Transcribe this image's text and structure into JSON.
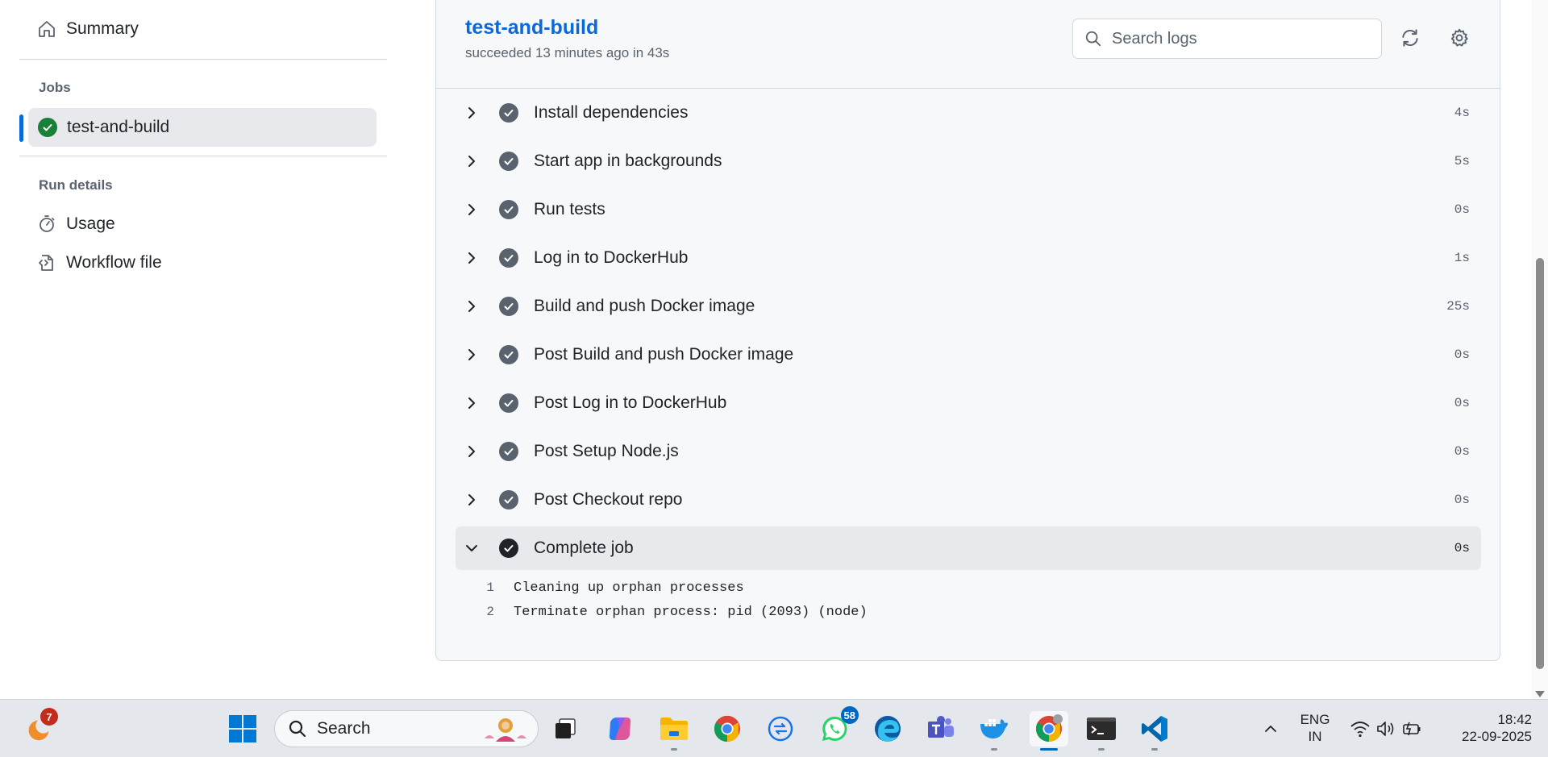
{
  "sidebar": {
    "summary_label": "Summary",
    "jobs_heading": "Jobs",
    "active_job": "test-and-build",
    "run_details_heading": "Run details",
    "usage_label": "Usage",
    "workflow_label": "Workflow file"
  },
  "job": {
    "title": "test-and-build",
    "subtitle": "succeeded 13 minutes ago in 43s",
    "search_placeholder": "Search logs"
  },
  "steps": [
    {
      "name": "Install dependencies",
      "duration": "4s"
    },
    {
      "name": "Start app in backgrounds",
      "duration": "5s"
    },
    {
      "name": "Run tests",
      "duration": "0s"
    },
    {
      "name": "Log in to DockerHub",
      "duration": "1s"
    },
    {
      "name": "Build and push Docker image",
      "duration": "25s"
    },
    {
      "name": "Post Build and push Docker image",
      "duration": "0s"
    },
    {
      "name": "Post Log in to DockerHub",
      "duration": "0s"
    },
    {
      "name": "Post Setup Node.js",
      "duration": "0s"
    },
    {
      "name": "Post Checkout repo",
      "duration": "0s"
    },
    {
      "name": "Complete job",
      "duration": "0s",
      "expanded": true
    }
  ],
  "log_lines": [
    {
      "num": "1",
      "text": "Cleaning up orphan processes"
    },
    {
      "num": "2",
      "text": "Terminate orphan process: pid (2093) (node)"
    }
  ],
  "taskbar": {
    "search_label": "Search",
    "weather_badge": "7",
    "whatsapp_badge": "58",
    "lang_line1": "ENG",
    "lang_line2": "IN",
    "time": "18:42",
    "date": "22-09-2025"
  },
  "colors": {
    "accent": "#0969da",
    "success": "#1a7f37",
    "step_icon": "#59636e",
    "badge_red": "#c42b1c",
    "badge_blue": "#0067c0"
  }
}
